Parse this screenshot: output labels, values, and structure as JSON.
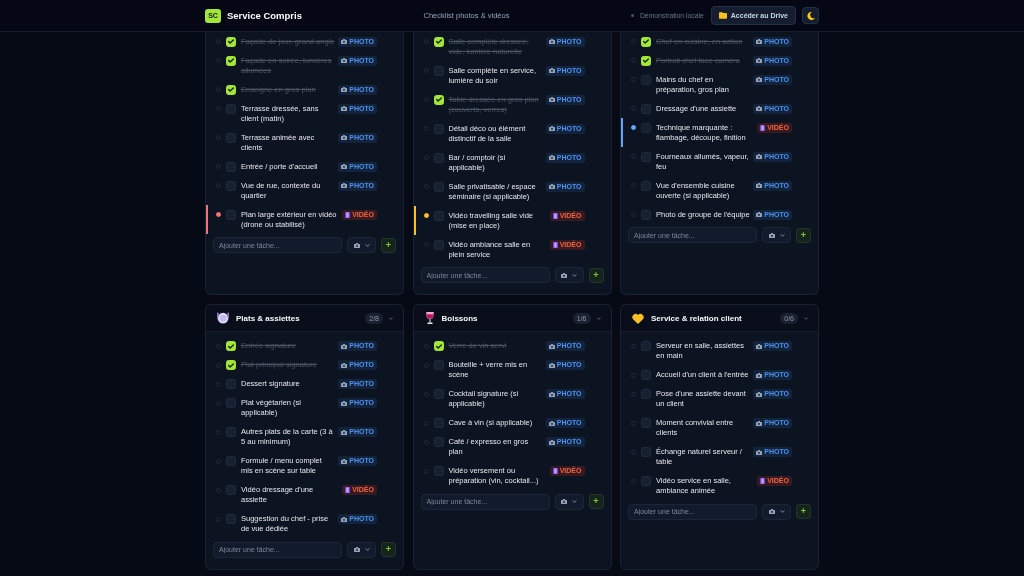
{
  "header": {
    "logo": "SC",
    "title": "Service Compris",
    "subtitle": "Checklist photos & vidéos",
    "status": "Démonstration locale",
    "drive_button": "Accéder au Drive"
  },
  "groups": [
    {
      "kind": "continued",
      "items": [
        {
          "label": "Façade de jour, grand angle",
          "checked": true,
          "kind": "photo",
          "badge": "PHOTO"
        },
        {
          "label": "Façade en soirée, lumières allumées",
          "checked": true,
          "kind": "photo",
          "badge": "PHOTO"
        },
        {
          "label": "Enseigne en gros plan",
          "checked": true,
          "kind": "photo",
          "badge": "PHOTO"
        },
        {
          "label": "Terrasse dressée, sans client (matin)",
          "checked": false,
          "kind": "photo",
          "badge": "PHOTO"
        },
        {
          "label": "Terrasse animée avec clients",
          "checked": false,
          "kind": "photo",
          "badge": "PHOTO"
        },
        {
          "label": "Entrée / porte d'accueil",
          "checked": false,
          "kind": "photo",
          "badge": "PHOTO"
        },
        {
          "label": "Vue de rue, contexte du quartier",
          "checked": false,
          "kind": "photo",
          "badge": "PHOTO"
        },
        {
          "label": "Plan large extérieur en vidéo (drone ou stabilisé)",
          "checked": false,
          "color": "#f87171",
          "kind": "video",
          "badge": "VIDÉO"
        }
      ],
      "add": {
        "placeholder": "Ajouter une tâche...",
        "button": "+"
      }
    },
    {
      "kind": "continued",
      "items": [
        {
          "label": "Salle complète dressée, vide, lumière naturelle",
          "checked": true,
          "kind": "photo",
          "badge": "PHOTO"
        },
        {
          "label": "Salle complète en service, lumière du soir",
          "checked": false,
          "kind": "photo",
          "badge": "PHOTO"
        },
        {
          "label": "Table dressée en gros plan (couverts, verres)",
          "checked": true,
          "kind": "photo",
          "badge": "PHOTO"
        },
        {
          "label": "Détail déco ou élément distinctif de la salle",
          "checked": false,
          "kind": "photo",
          "badge": "PHOTO"
        },
        {
          "label": "Bar / comptoir (si applicable)",
          "checked": false,
          "kind": "photo",
          "badge": "PHOTO"
        },
        {
          "label": "Salle privatisable / espace séminaire (si applicable)",
          "checked": false,
          "kind": "photo",
          "badge": "PHOTO"
        },
        {
          "label": "Vidéo travelling salle vide (mise en place)",
          "checked": false,
          "color": "#fbbf24",
          "kind": "video",
          "badge": "VIDÉO"
        },
        {
          "label": "Vidéo ambiance salle en plein service",
          "checked": false,
          "kind": "video",
          "badge": "VIDÉO"
        }
      ],
      "add": {
        "placeholder": "Ajouter une tâche...",
        "button": "+"
      }
    },
    {
      "kind": "continued",
      "items": [
        {
          "label": "Chef en cuisine, en action",
          "checked": true,
          "kind": "photo",
          "badge": "PHOTO"
        },
        {
          "label": "Portrait chef face caméra",
          "checked": true,
          "kind": "photo",
          "badge": "PHOTO"
        },
        {
          "label": "Mains du chef en préparation, gros plan",
          "checked": false,
          "kind": "photo",
          "badge": "PHOTO"
        },
        {
          "label": "Dressage d'une assiette",
          "checked": false,
          "kind": "photo",
          "badge": "PHOTO"
        },
        {
          "label": "Technique marquante : flambage, découpe, finition",
          "checked": false,
          "color": "#60a5fa",
          "kind": "video",
          "badge": "VIDÉO"
        },
        {
          "label": "Fourneaux allumés, vapeur, feu",
          "checked": false,
          "kind": "photo",
          "badge": "PHOTO"
        },
        {
          "label": "Vue d'ensemble cuisine ouverte (si applicable)",
          "checked": false,
          "kind": "photo",
          "badge": "PHOTO"
        },
        {
          "label": "Photo de groupe de l'équipe",
          "checked": false,
          "kind": "photo",
          "badge": "PHOTO"
        }
      ],
      "add": {
        "placeholder": "Ajouter une tâche...",
        "button": "+"
      }
    },
    {
      "kind": "dishes",
      "title": "Plats & assiettes",
      "count": "2/8",
      "items": [
        {
          "label": "Entrée signature",
          "checked": true,
          "kind": "photo",
          "badge": "PHOTO"
        },
        {
          "label": "Plat principal signature",
          "checked": true,
          "kind": "photo",
          "badge": "PHOTO"
        },
        {
          "label": "Dessert signature",
          "checked": false,
          "kind": "photo",
          "badge": "PHOTO"
        },
        {
          "label": "Plat végétarien (si applicable)",
          "checked": false,
          "kind": "photo",
          "badge": "PHOTO"
        },
        {
          "label": "Autres plats de la carte (3 à 5 au minimum)",
          "checked": false,
          "kind": "photo",
          "badge": "PHOTO"
        },
        {
          "label": "Formule / menu complet mis en scène sur table",
          "checked": false,
          "kind": "photo",
          "badge": "PHOTO"
        },
        {
          "label": "Vidéo dressage d'une assiette",
          "checked": false,
          "kind": "video",
          "badge": "VIDÉO"
        },
        {
          "label": "Suggestion du chef - prise de vue dédiée",
          "checked": false,
          "kind": "photo",
          "badge": "PHOTO"
        }
      ],
      "add": {
        "placeholder": "Ajouter une tâche...",
        "button": "+"
      }
    },
    {
      "kind": "drinks",
      "title": "Boissons",
      "count": "1/6",
      "items": [
        {
          "label": "Verre de vin servi",
          "checked": true,
          "kind": "photo",
          "badge": "PHOTO"
        },
        {
          "label": "Bouteille + verre mis en scène",
          "checked": false,
          "kind": "photo",
          "badge": "PHOTO"
        },
        {
          "label": "Cocktail signature (si applicable)",
          "checked": false,
          "kind": "photo",
          "badge": "PHOTO"
        },
        {
          "label": "Cave à vin (si applicable)",
          "checked": false,
          "kind": "photo",
          "badge": "PHOTO"
        },
        {
          "label": "Café / expresso en gros plan",
          "checked": false,
          "kind": "photo",
          "badge": "PHOTO"
        },
        {
          "label": "Vidéo versement ou préparation (vin, cocktail...)",
          "checked": false,
          "kind": "video",
          "badge": "VIDÉO"
        }
      ],
      "add": {
        "placeholder": "Ajouter une tâche...",
        "button": "+"
      }
    },
    {
      "kind": "service",
      "title": "Service & relation client",
      "count": "0/6",
      "items": [
        {
          "label": "Serveur en salle, assiettes en main",
          "checked": false,
          "kind": "photo",
          "badge": "PHOTO"
        },
        {
          "label": "Accueil d'un client à l'entrée",
          "checked": false,
          "kind": "photo",
          "badge": "PHOTO"
        },
        {
          "label": "Pose d'une assiette devant un client",
          "checked": false,
          "kind": "photo",
          "badge": "PHOTO"
        },
        {
          "label": "Moment convivial entre clients",
          "checked": false,
          "kind": "photo",
          "badge": "PHOTO"
        },
        {
          "label": "Échange naturel serveur / table",
          "checked": false,
          "kind": "photo",
          "badge": "PHOTO"
        },
        {
          "label": "Vidéo service en salle, ambiance animée",
          "checked": false,
          "kind": "video",
          "badge": "VIDÉO"
        }
      ],
      "add": {
        "placeholder": "Ajouter une tâche...",
        "button": "+"
      }
    }
  ]
}
